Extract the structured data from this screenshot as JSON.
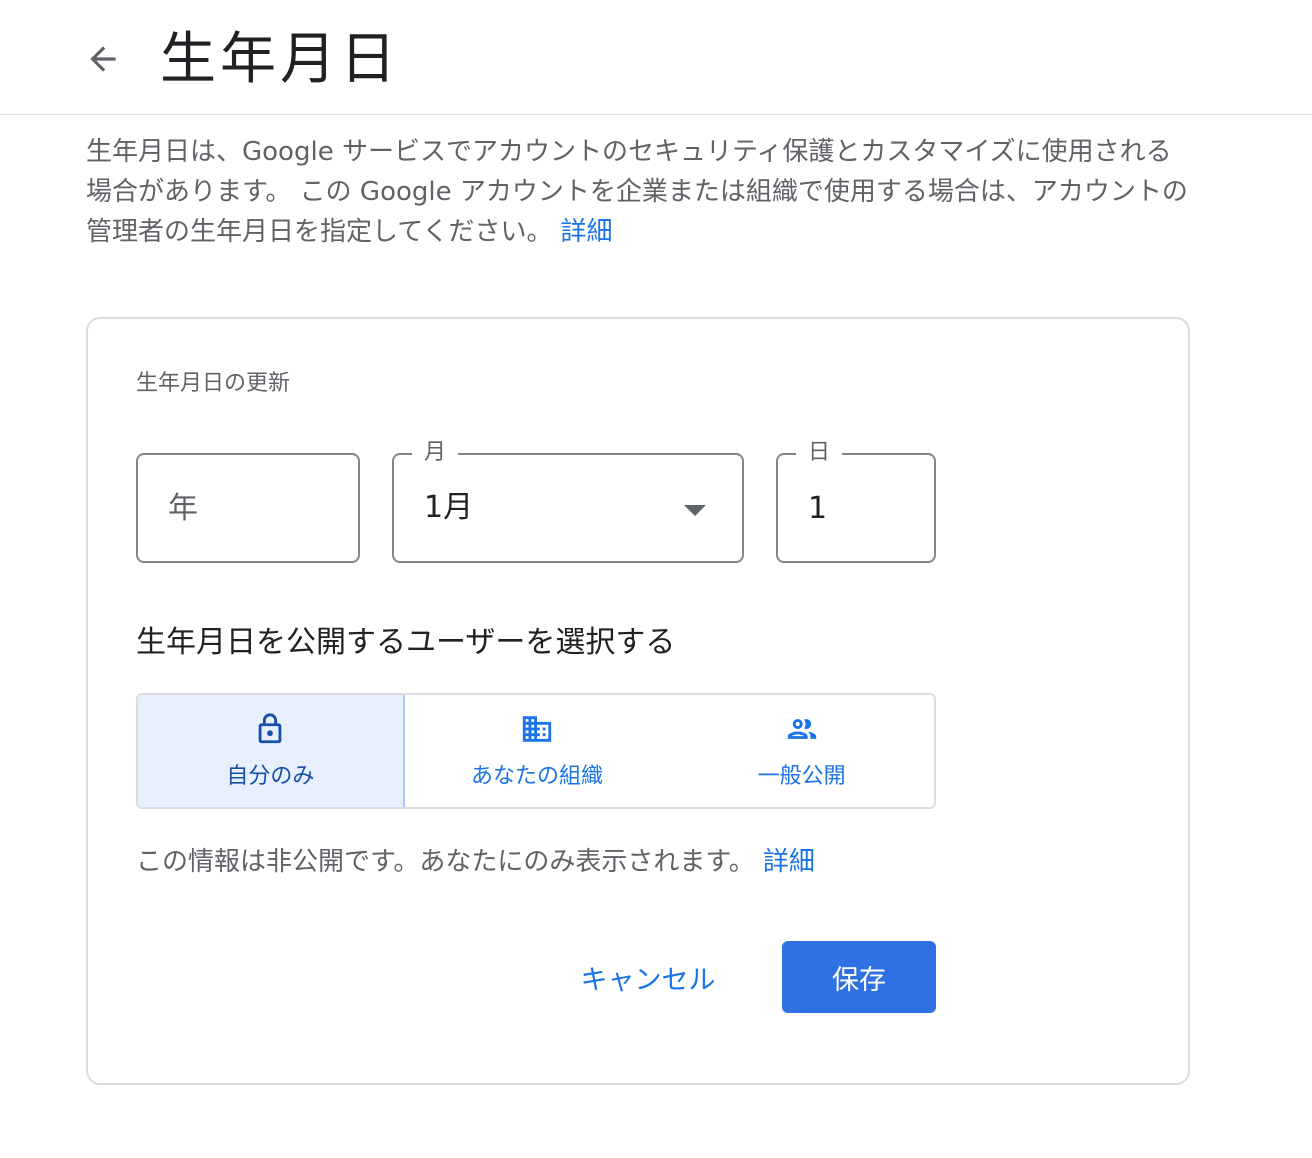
{
  "header": {
    "title": "生年月日",
    "back_icon": "arrow-back-icon"
  },
  "description": {
    "text": "生年月日は、Google サービスでアカウントのセキュリティ保護とカスタマイズに使用される場合があります。 この Google アカウントを企業または組織で使用する場合は、アカウントの管理者の生年月日を指定してください。",
    "link": "詳細"
  },
  "form": {
    "section_label": "生年月日の更新",
    "year": {
      "placeholder": "年",
      "value": ""
    },
    "month": {
      "label": "月",
      "value": "1月",
      "icon": "dropdown-arrow-icon"
    },
    "day": {
      "label": "日",
      "value": "1"
    },
    "visibility_heading": "生年月日を公開するユーザーを選択する",
    "visibility_options": [
      {
        "label": "自分のみ",
        "icon": "lock-icon",
        "selected": true
      },
      {
        "label": "あなたの組織",
        "icon": "domain-icon",
        "selected": false
      },
      {
        "label": "一般公開",
        "icon": "people-icon",
        "selected": false
      }
    ],
    "privacy_note": "この情報は非公開です。あなたにのみ表示されます。",
    "privacy_link": "詳細",
    "cancel_label": "キャンセル",
    "save_label": "保存"
  },
  "colors": {
    "accent": "#1a73e8",
    "primary_button": "#2f70e2",
    "selected_background": "#e8f0fe",
    "border": "#dadce0"
  }
}
